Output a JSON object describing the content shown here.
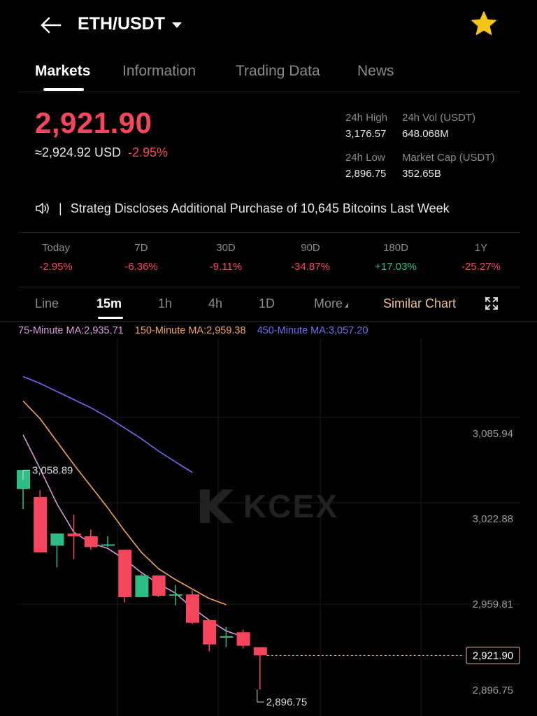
{
  "header": {
    "pair": "ETH/USDT"
  },
  "tabs": [
    "Markets",
    "Information",
    "Trading Data",
    "News"
  ],
  "ticker": {
    "last_price": "2,921.90",
    "usd_equiv": "≈2,924.92 USD",
    "change_pct": "-2.95%",
    "high_label": "24h High",
    "high_value": "3,176.57",
    "vol_label": "24h Vol (USDT)",
    "vol_value": "648.068M",
    "low_label": "24h Low",
    "low_value": "2,896.75",
    "cap_label": "Market Cap (USDT)",
    "cap_value": "352.65B"
  },
  "news": {
    "headline": "Strateg Discloses Additional Purchase of 10,645 Bitcoins Last Week"
  },
  "performance": [
    {
      "label": "Today",
      "value": "-2.95%",
      "trend": "down"
    },
    {
      "label": "7D",
      "value": "-6.36%",
      "trend": "down"
    },
    {
      "label": "30D",
      "value": "-9.11%",
      "trend": "down"
    },
    {
      "label": "90D",
      "value": "-34.87%",
      "trend": "down"
    },
    {
      "label": "180D",
      "value": "+17.03%",
      "trend": "up"
    },
    {
      "label": "1Y",
      "value": "-25.27%",
      "trend": "down"
    }
  ],
  "timeframes": {
    "line": "Line",
    "m15": "15m",
    "h1": "1h",
    "h4": "4h",
    "d1": "1D",
    "more": "More",
    "similar": "Similar Chart"
  },
  "ma_legend": {
    "ma75": "75-Minute MA:2,935.71",
    "ma150": "150-Minute MA:2,959.38",
    "ma450": "450-Minute MA:3,057.20"
  },
  "colors": {
    "up": "#2ebd85",
    "down": "#f6465d",
    "ma75": "#d79ad9",
    "ma150": "#f0a45a",
    "ma450": "#7b67f0",
    "accent": "#e8c38b"
  },
  "chart_data": {
    "type": "candlestick",
    "y_axis_labels": [
      "3,085.94",
      "3,022.88",
      "2,959.81",
      "2,896.75"
    ],
    "last_price_label": "2,921.90",
    "high_marker": "3,058.89",
    "low_marker": "2,896.75",
    "watermark": "KCEX",
    "candles": [
      {
        "o": 3045,
        "h": 3059,
        "l": 3030,
        "c": 3059
      },
      {
        "o": 3039,
        "h": 3044,
        "l": 3008,
        "c": 2998
      },
      {
        "o": 3003,
        "h": 3012,
        "l": 2987,
        "c": 3012
      },
      {
        "o": 3012,
        "h": 3026,
        "l": 2993,
        "c": 3010
      },
      {
        "o": 3010,
        "h": 3015,
        "l": 3000,
        "c": 3002
      },
      {
        "o": 3003,
        "h": 3010,
        "l": 3002,
        "c": 3004
      },
      {
        "o": 3000,
        "h": 3000,
        "l": 2961,
        "c": 2965
      },
      {
        "o": 2965,
        "h": 2982,
        "l": 2965,
        "c": 2981
      },
      {
        "o": 2981,
        "h": 2981,
        "l": 2965,
        "c": 2966
      },
      {
        "o": 2967,
        "h": 2974,
        "l": 2959,
        "c": 2967
      },
      {
        "o": 2967,
        "h": 2970,
        "l": 2945,
        "c": 2946
      },
      {
        "o": 2948,
        "h": 2948,
        "l": 2925,
        "c": 2930
      },
      {
        "o": 2936,
        "h": 2943,
        "l": 2928,
        "c": 2936
      },
      {
        "o": 2939,
        "h": 2941,
        "l": 2927,
        "c": 2929
      },
      {
        "o": 2928,
        "h": 2928,
        "l": 2896.75,
        "c": 2921.9
      }
    ],
    "ma75": [
      3085,
      3060,
      3034,
      3013,
      3005,
      3001,
      2993,
      2983,
      2975,
      2968,
      2957,
      2948,
      2940,
      2935.71
    ],
    "ma150": [
      3110,
      3097,
      3080,
      3063,
      3047,
      3031,
      3014,
      2998,
      2986,
      2978,
      2971,
      2964,
      2959.38
    ],
    "ma450": [
      3128,
      3123,
      3117,
      3111,
      3105,
      3098,
      3090,
      3082,
      3073,
      3065,
      3057.2
    ]
  }
}
